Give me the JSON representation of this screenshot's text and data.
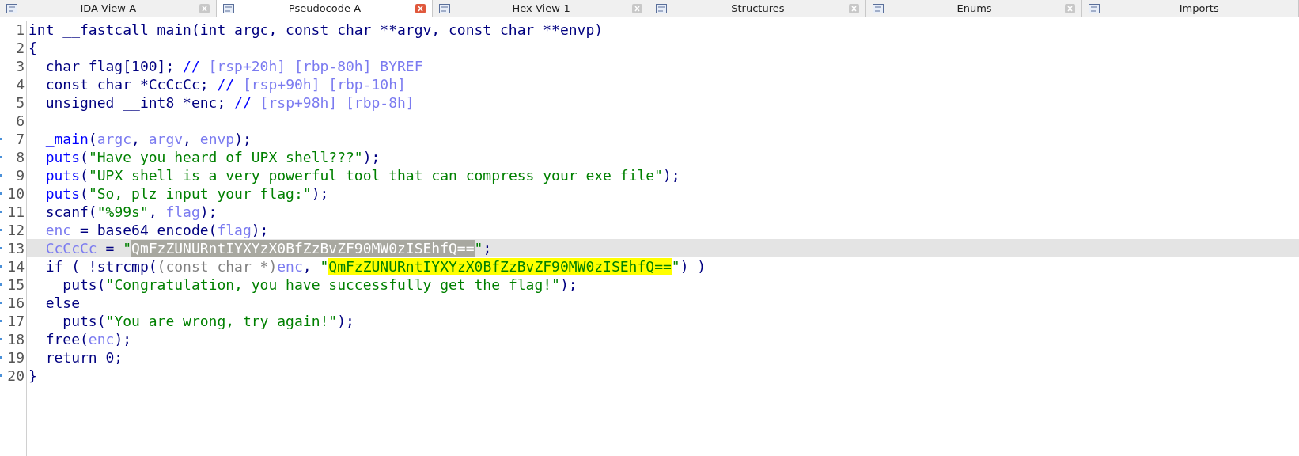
{
  "tabs": [
    {
      "label": "IDA View-A",
      "selected": false,
      "closable": true
    },
    {
      "label": "Pseudocode-A",
      "selected": true,
      "closable": true
    },
    {
      "label": "Hex View-1",
      "selected": false,
      "closable": true
    },
    {
      "label": "Structures",
      "selected": false,
      "closable": true
    },
    {
      "label": "Enums",
      "selected": false,
      "closable": true
    },
    {
      "label": "Imports",
      "selected": false,
      "closable": false
    }
  ],
  "lines": [
    {
      "number": "1",
      "marked": false,
      "current": false,
      "tokens": [
        {
          "text": "int __fastcall main(int argc, const char **argv, const char **envp)",
          "kind": "code"
        }
      ]
    },
    {
      "number": "2",
      "marked": false,
      "current": false,
      "tokens": [
        {
          "text": "{",
          "kind": "code"
        }
      ]
    },
    {
      "number": "3",
      "marked": false,
      "current": false,
      "tokens": [
        {
          "text": "  char flag[100]; ",
          "kind": "code"
        },
        {
          "text": "//",
          "kind": "comment_mark"
        },
        {
          "text": " [rsp+20h] [rbp-80h] BYREF",
          "kind": "comment"
        }
      ]
    },
    {
      "number": "4",
      "marked": false,
      "current": false,
      "tokens": [
        {
          "text": "  const char *CcCcCc; ",
          "kind": "code"
        },
        {
          "text": "//",
          "kind": "comment_mark"
        },
        {
          "text": " [rsp+90h] [rbp-10h]",
          "kind": "comment"
        }
      ]
    },
    {
      "number": "5",
      "marked": false,
      "current": false,
      "tokens": [
        {
          "text": "  unsigned __int8 *enc; ",
          "kind": "code"
        },
        {
          "text": "//",
          "kind": "comment_mark"
        },
        {
          "text": " [rsp+98h] [rbp-8h]",
          "kind": "comment"
        }
      ]
    },
    {
      "number": "6",
      "marked": false,
      "current": false
    },
    {
      "number": "7",
      "marked": true,
      "current": false,
      "tokens": [
        {
          "text": "  _main",
          "kind": "func"
        },
        {
          "text": "(",
          "kind": "code"
        },
        {
          "text": "argc",
          "kind": "var"
        },
        {
          "text": ", ",
          "kind": "code"
        },
        {
          "text": "argv",
          "kind": "var"
        },
        {
          "text": ", ",
          "kind": "code"
        },
        {
          "text": "envp",
          "kind": "var"
        },
        {
          "text": ");",
          "kind": "code"
        }
      ]
    },
    {
      "number": "8",
      "marked": true,
      "current": false,
      "tokens": [
        {
          "text": "  puts",
          "kind": "func"
        },
        {
          "text": "(",
          "kind": "code"
        },
        {
          "text": "\"Have you heard of UPX shell???\"",
          "kind": "string"
        },
        {
          "text": ");",
          "kind": "code"
        }
      ]
    },
    {
      "number": "9",
      "marked": true,
      "current": false,
      "tokens": [
        {
          "text": "  puts",
          "kind": "func"
        },
        {
          "text": "(",
          "kind": "code"
        },
        {
          "text": "\"UPX shell is a very powerful tool that can compress your exe file\"",
          "kind": "string"
        },
        {
          "text": ");",
          "kind": "code"
        }
      ]
    },
    {
      "number": "10",
      "marked": true,
      "current": false,
      "tokens": [
        {
          "text": "  puts",
          "kind": "func"
        },
        {
          "text": "(",
          "kind": "code"
        },
        {
          "text": "\"So, plz input your flag:\"",
          "kind": "string"
        },
        {
          "text": ");",
          "kind": "code"
        }
      ]
    },
    {
      "number": "11",
      "marked": true,
      "current": false,
      "tokens": [
        {
          "text": "  scanf(",
          "kind": "code"
        },
        {
          "text": "\"%99s\"",
          "kind": "string"
        },
        {
          "text": ", ",
          "kind": "code"
        },
        {
          "text": "flag",
          "kind": "var"
        },
        {
          "text": ");",
          "kind": "code"
        }
      ]
    },
    {
      "number": "12",
      "marked": true,
      "current": false,
      "tokens": [
        {
          "text": "  enc",
          "kind": "var"
        },
        {
          "text": " = base64_encode(",
          "kind": "code"
        },
        {
          "text": "flag",
          "kind": "var"
        },
        {
          "text": ");",
          "kind": "code"
        }
      ]
    },
    {
      "number": "13",
      "marked": true,
      "current": true,
      "tokens": [
        {
          "text": "  CcCcCc",
          "kind": "var"
        },
        {
          "text": " = ",
          "kind": "code"
        },
        {
          "text": "\"",
          "kind": "string"
        },
        {
          "text": "QmFzZUNURntIYXYzX0BfZzBvZF90MW0zISEhfQ==",
          "kind": "selection"
        },
        {
          "text": "\"",
          "kind": "string"
        },
        {
          "text": ";",
          "kind": "code"
        }
      ]
    },
    {
      "number": "14",
      "marked": true,
      "current": false,
      "tokens": [
        {
          "text": "  if ( !strcmp(",
          "kind": "code"
        },
        {
          "text": "(const char *)",
          "kind": "cast"
        },
        {
          "text": "enc",
          "kind": "var"
        },
        {
          "text": ", ",
          "kind": "code"
        },
        {
          "text": "\"",
          "kind": "string"
        },
        {
          "text": "QmFzZUNURntIYXYzX0BfZzBvZF90MW0zISEhfQ==",
          "kind": "match"
        },
        {
          "text": "\"",
          "kind": "string"
        },
        {
          "text": ") )",
          "kind": "code"
        }
      ]
    },
    {
      "number": "15",
      "marked": true,
      "current": false,
      "tokens": [
        {
          "text": "    puts(",
          "kind": "code"
        },
        {
          "text": "\"Congratulation, you have successfully get the flag!\"",
          "kind": "string"
        },
        {
          "text": ");",
          "kind": "code"
        }
      ]
    },
    {
      "number": "16",
      "marked": true,
      "current": false,
      "tokens": [
        {
          "text": "  else",
          "kind": "code"
        }
      ]
    },
    {
      "number": "17",
      "marked": true,
      "current": false,
      "tokens": [
        {
          "text": "    puts(",
          "kind": "code"
        },
        {
          "text": "\"You are wrong, try again!\"",
          "kind": "string"
        },
        {
          "text": ");",
          "kind": "code"
        }
      ]
    },
    {
      "number": "18",
      "marked": true,
      "current": false,
      "tokens": [
        {
          "text": "  free(",
          "kind": "code"
        },
        {
          "text": "enc",
          "kind": "var"
        },
        {
          "text": ");",
          "kind": "code"
        }
      ]
    },
    {
      "number": "19",
      "marked": true,
      "current": false,
      "tokens": [
        {
          "text": "  return 0;",
          "kind": "code"
        }
      ]
    },
    {
      "number": "20",
      "marked": true,
      "current": false,
      "tokens": [
        {
          "text": "}",
          "kind": "code"
        }
      ]
    }
  ]
}
